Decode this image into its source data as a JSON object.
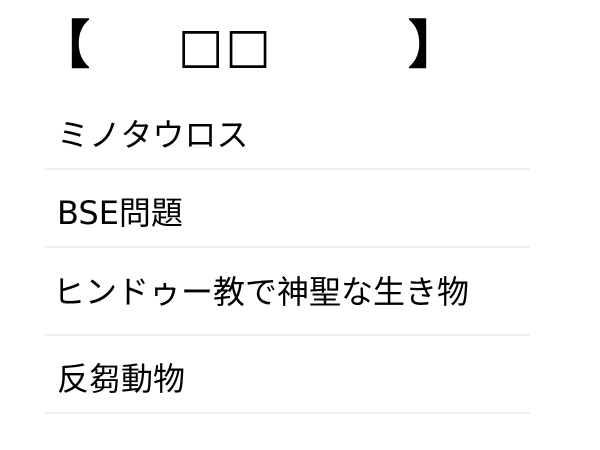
{
  "title": {
    "bracket_left": "【",
    "text": "□□",
    "bracket_right": "】"
  },
  "items": [
    {
      "label": "ミノタウロス"
    },
    {
      "label": "BSE問題"
    },
    {
      "label": "ヒンドゥー教で神聖な生き物"
    },
    {
      "label": "反芻動物"
    }
  ]
}
